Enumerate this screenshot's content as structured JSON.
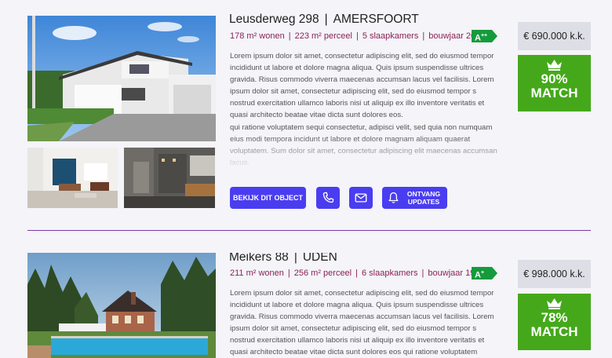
{
  "listings": [
    {
      "street": "Leusderweg 298",
      "city": "AMERSFOORT",
      "specs": [
        "178 m² wonen",
        "223 m² perceel",
        "5 slaapkamers",
        "bouwjaar 2002"
      ],
      "energy_label": "A",
      "energy_sup": "++",
      "description": [
        "Lorem ipsum dolor sit amet, consectetur adipiscing elit, sed do eiusmod tempor incididunt ut labore et dolore magna aliqua. Quis ipsum suspendisse ultrices gravida. Risus commodo viverra maecenas accumsan lacus vel facilisis. Lorem ipsum dolor sit amet, consectetur adipiscing elit, sed do eiusmod tempor s nostrud exercitation ullamco laboris nisi ut aliquip ex  illo inventore veritatis et quasi architecto beatae vitae dicta sunt dolores eos.",
        " qui ratione voluptatem sequi consectetur, adipisci velit, sed quia non numquam eius modi tempora incidunt ut labore et dolore magnam aliquam quaerat voluptatem. Sum dolor sit amet, consectetur adipiscing elit maecenas accumsan lacus."
      ],
      "price": "€ 690.000 k.k.",
      "match_pct": "90%",
      "match_label": "MATCH",
      "buttons": {
        "view": "BEKIJK DIT OBJECT",
        "updates_line1": "ONTVANG",
        "updates_line2": "UPDATES"
      }
    },
    {
      "street": "Meikers 88",
      "city": "UDEN",
      "specs": [
        "211 m² wonen",
        "256 m² perceel",
        "6 slaapkamers",
        "bouwjaar 1996"
      ],
      "energy_label": "A",
      "energy_sup": "+",
      "description": [
        "Lorem ipsum dolor sit amet, consectetur adipiscing elit, sed do eiusmod tempor incididunt ut labore et dolore magna aliqua. Quis ipsum suspendisse ultrices gravida. Risus commodo viverra maecenas accumsan lacus vel facilisis. Lorem ipsum dolor sit amet, consectetur adipiscing elit, sed do eiusmod tempor s nostrud exercitation ullamco laboris nisi ut aliquip ex  illo inventore veritatis et quasi architecto beatae vitae dicta sunt dolores eos qui ratione voluptatem"
      ],
      "price": "€ 998.000 k.k.",
      "match_pct": "78%",
      "match_label": "MATCH"
    }
  ],
  "icons": {
    "phone": "phone-icon",
    "mail": "mail-icon",
    "bell": "bell-icon",
    "crown": "crown-icon"
  },
  "colors": {
    "accent": "#4a3df0",
    "match_green": "#45a81b",
    "energy_green": "#159b3c",
    "spec_text": "#8b2259",
    "divider": "#7a3aa8"
  }
}
